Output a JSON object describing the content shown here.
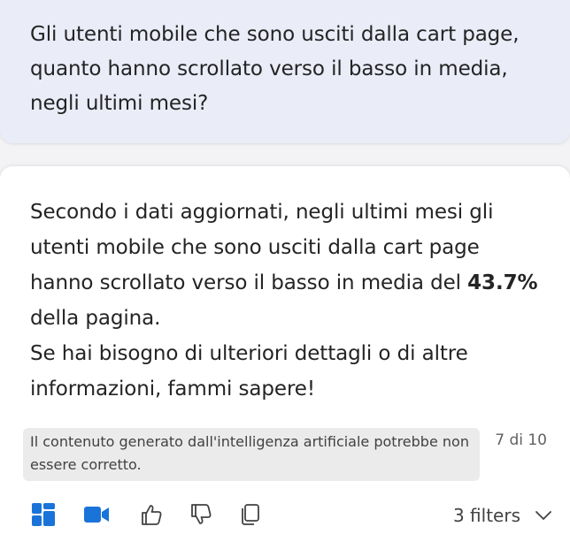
{
  "user_message": {
    "text": "Gli utenti mobile che sono usciti dalla cart page, quanto hanno scrollato verso il basso in media, negli ultimi mesi?"
  },
  "response": {
    "line1": "Secondo i dati aggiornati, negli ultimi mesi gli utenti mobile che sono usciti dalla cart page hanno scrollato verso il basso in media del ",
    "highlight": "43.7%",
    "line1_tail": " della pagina.",
    "line2": "Se hai bisogno di ulteriori dettagli o di altre informazioni, fammi sapere!"
  },
  "disclaimer": "Il contenuto generato dall'intelligenza artificiale potrebbe non essere corretto.",
  "page_counter": "7 di 10",
  "toolbar": {
    "icons": [
      "dashboard-icon",
      "video-icon",
      "thumbs-up-icon",
      "thumbs-down-icon",
      "copy-icon",
      "chevron-down-icon"
    ],
    "filters_label": "3 filters"
  },
  "colors": {
    "accent": "#1a73d9",
    "user_bubble": "#eaecf8",
    "card": "#ffffff",
    "disclaimer_bg": "#ebebeb"
  }
}
